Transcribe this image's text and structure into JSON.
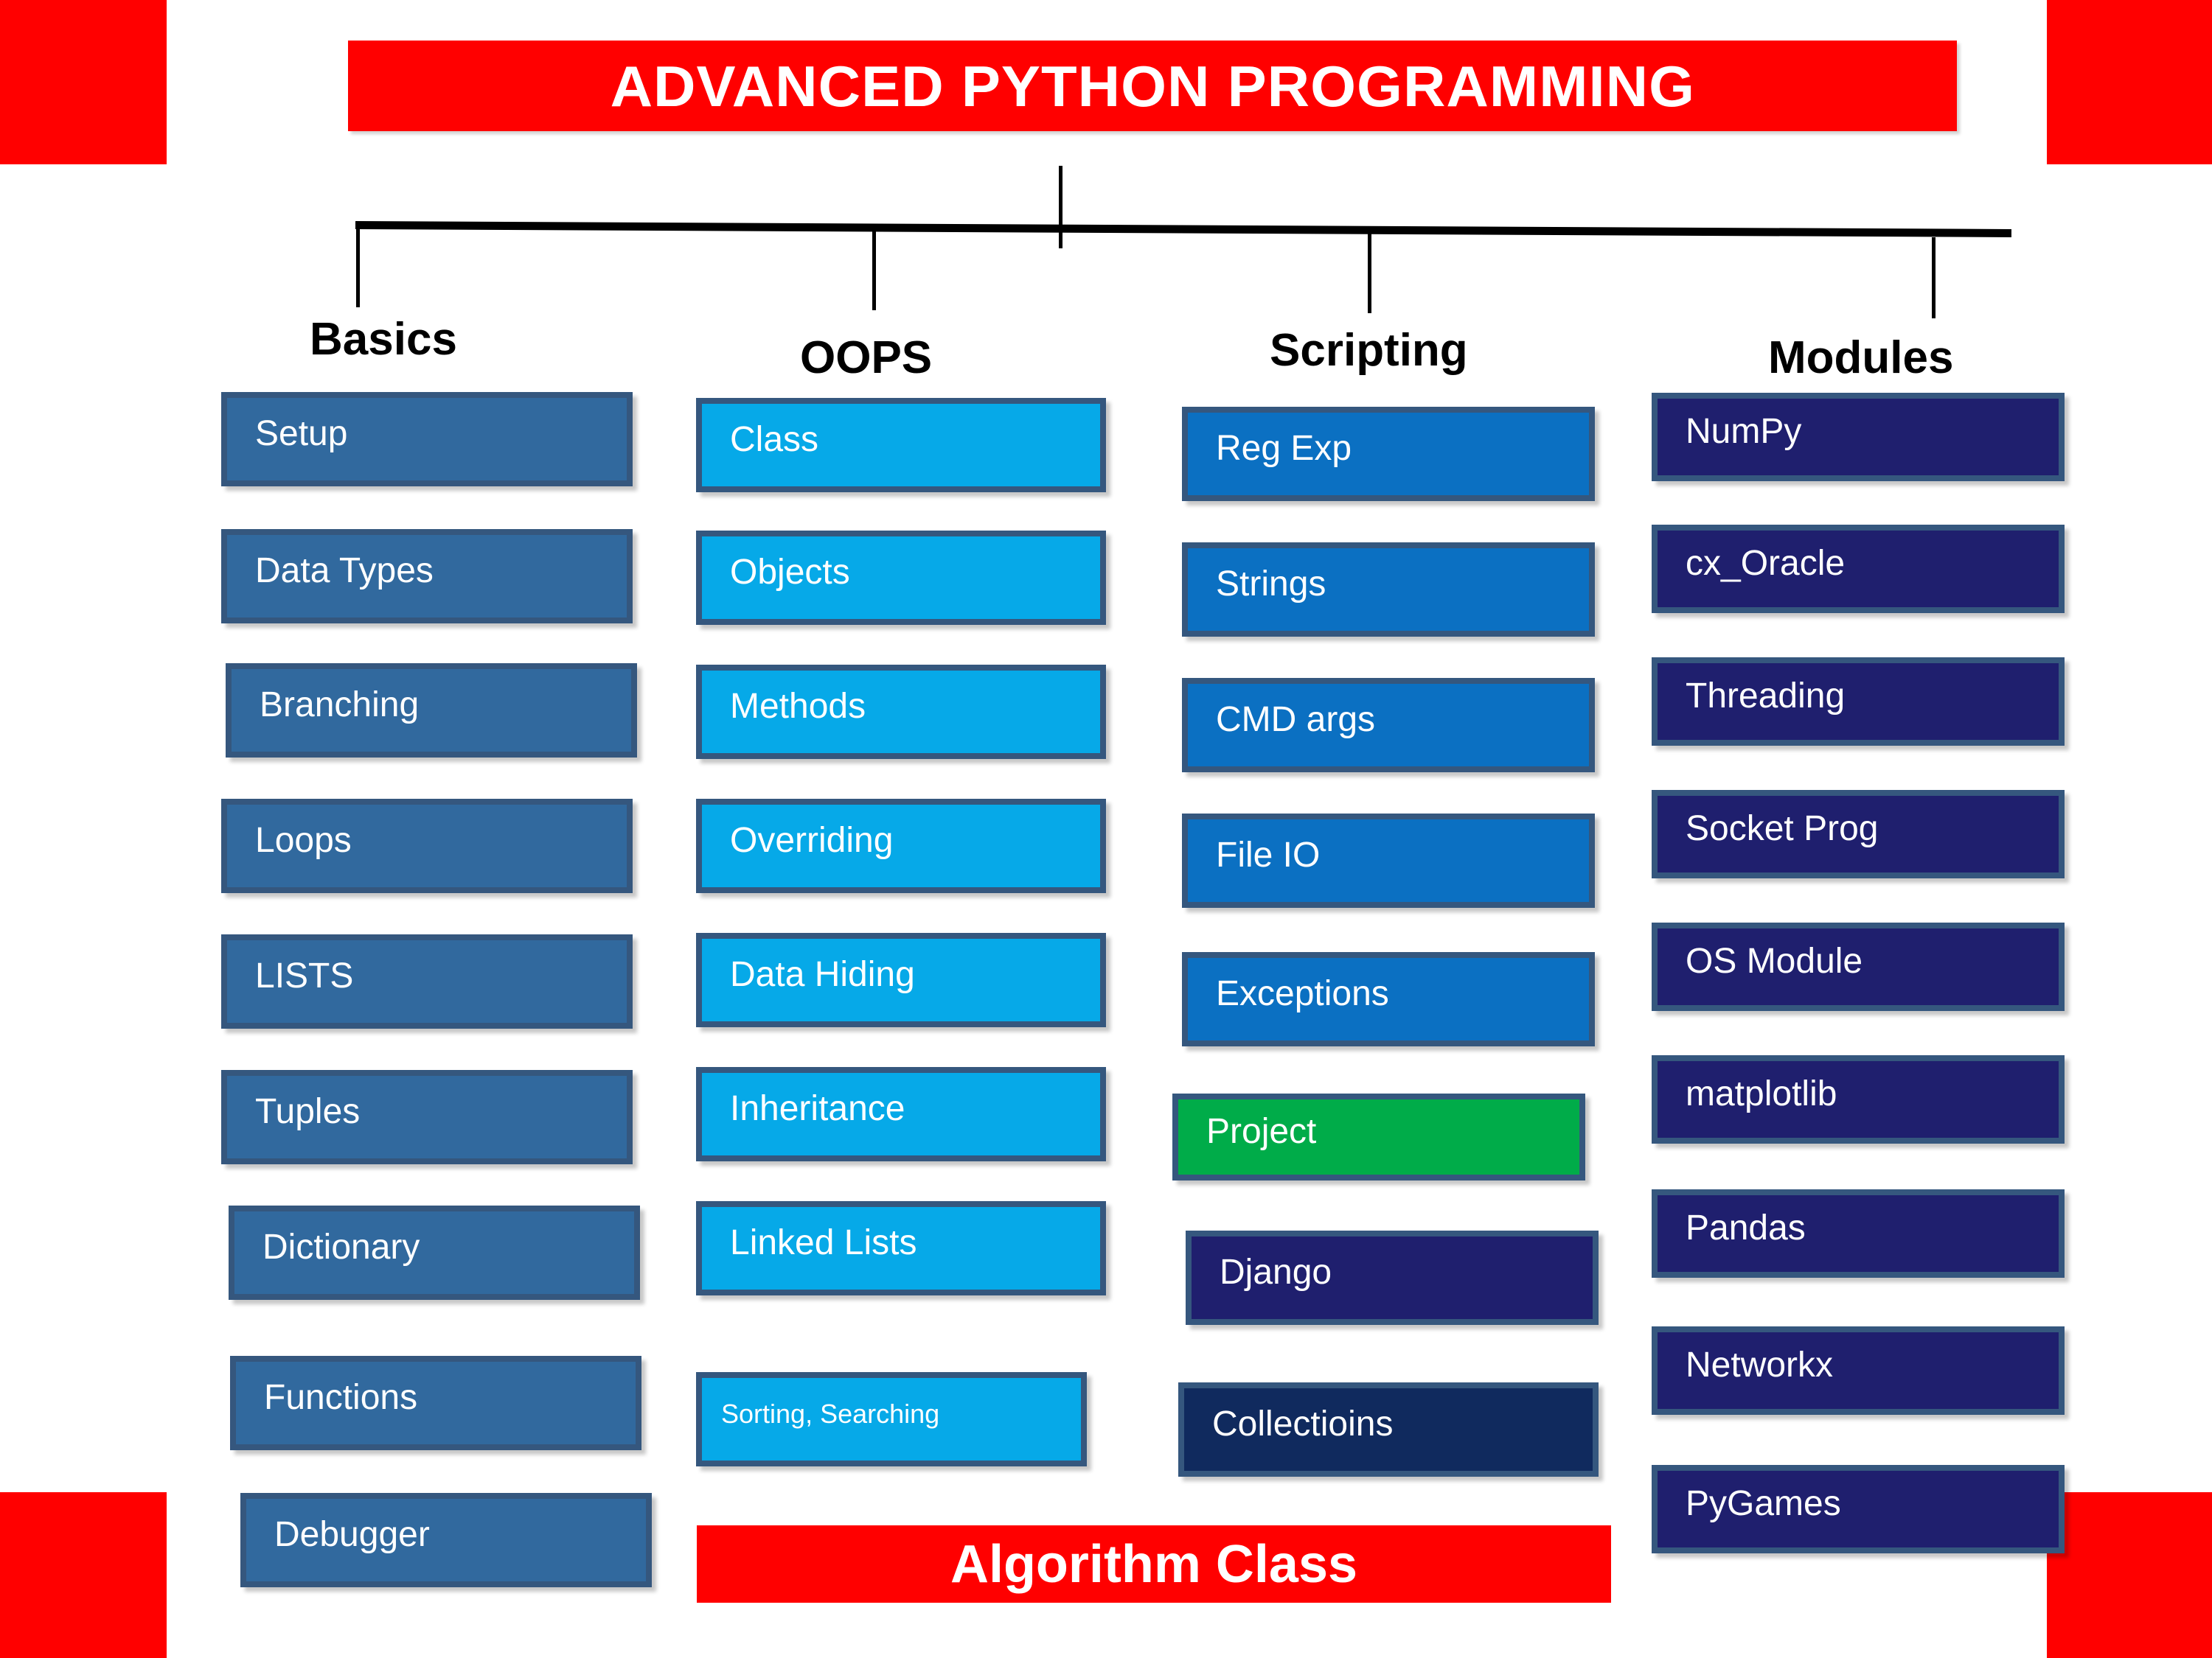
{
  "title": {
    "text": "ADVANCED PYTHON PROGRAMMING",
    "background_color": "#ff0000",
    "text_color": "#ffffff"
  },
  "footer_banner": {
    "text": "Algorithm Class",
    "background_color": "#ff0000",
    "text_color": "#ffffff"
  },
  "decor": {
    "corner_color": "#ff0000"
  },
  "columns": [
    {
      "id": "basics",
      "header": "Basics",
      "fill_color": "#31699e",
      "items": [
        {
          "label": "Setup"
        },
        {
          "label": "Data Types"
        },
        {
          "label": "Branching"
        },
        {
          "label": "Loops"
        },
        {
          "label": "LISTS"
        },
        {
          "label": "Tuples"
        },
        {
          "label": "Dictionary"
        },
        {
          "label": "Functions"
        },
        {
          "label": "Debugger"
        }
      ]
    },
    {
      "id": "oops",
      "header": "OOPS",
      "fill_color": "#06a9e8",
      "items": [
        {
          "label": "Class"
        },
        {
          "label": "Objects"
        },
        {
          "label": "Methods"
        },
        {
          "label": "Overriding"
        },
        {
          "label": "Data Hiding"
        },
        {
          "label": "Inheritance"
        },
        {
          "label": "Linked Lists"
        },
        {
          "label": "Sorting, Searching"
        }
      ]
    },
    {
      "id": "scripting",
      "header": "Scripting",
      "fill_color": "#0b70c2",
      "items": [
        {
          "label": "Reg Exp"
        },
        {
          "label": "Strings"
        },
        {
          "label": "CMD args"
        },
        {
          "label": "File IO"
        },
        {
          "label": "Exceptions"
        },
        {
          "label": "Project",
          "fill_color": "#00ac49"
        },
        {
          "label": "Django",
          "fill_color": "#1f1f6e"
        },
        {
          "label": "Collectioins",
          "fill_color": "#102a5e"
        }
      ]
    },
    {
      "id": "modules",
      "header": "Modules",
      "fill_color": "#1f1f6e",
      "items": [
        {
          "label": "NumPy"
        },
        {
          "label": "cx_Oracle"
        },
        {
          "label": "Threading"
        },
        {
          "label": "Socket Prog"
        },
        {
          "label": "OS Module"
        },
        {
          "label": "matplotlib"
        },
        {
          "label": "Pandas"
        },
        {
          "label": "Networkx"
        },
        {
          "label": "PyGames"
        }
      ]
    }
  ]
}
